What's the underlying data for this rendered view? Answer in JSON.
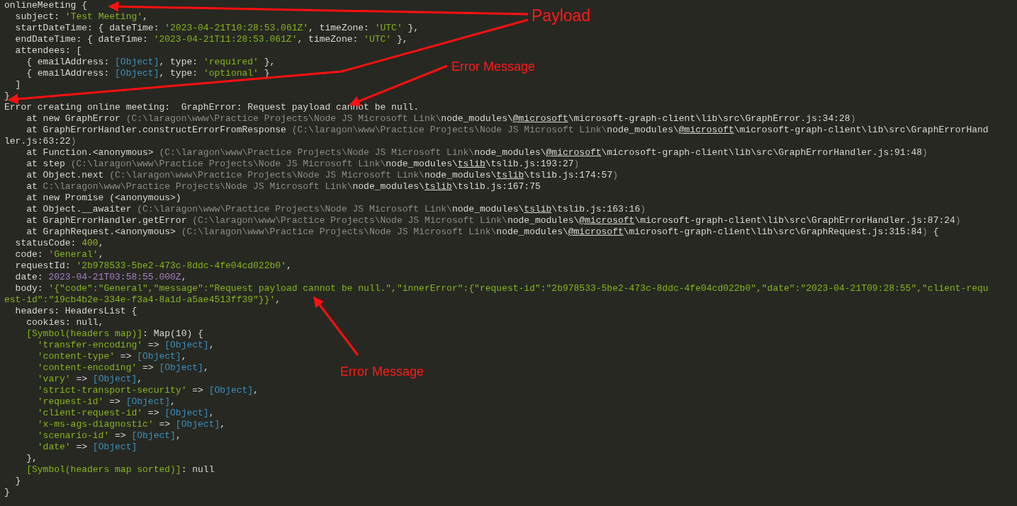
{
  "console": {
    "lines": [
      [
        {
          "kind": "t",
          "text": "onlineMeeting {"
        }
      ],
      [
        {
          "kind": "t",
          "text": "  subject: "
        },
        {
          "kind": "s",
          "text": "'Test Meeting'"
        },
        {
          "kind": "t",
          "text": ","
        }
      ],
      [
        {
          "kind": "t",
          "text": "  startDateTime: { dateTime: "
        },
        {
          "kind": "s",
          "text": "'2023-04-21T10:28:53.061Z'"
        },
        {
          "kind": "t",
          "text": ", timeZone: "
        },
        {
          "kind": "s",
          "text": "'UTC'"
        },
        {
          "kind": "t",
          "text": " },"
        }
      ],
      [
        {
          "kind": "t",
          "text": "  endDateTime: { dateTime: "
        },
        {
          "kind": "s",
          "text": "'2023-04-21T11:28:53.061Z'"
        },
        {
          "kind": "t",
          "text": ", timeZone: "
        },
        {
          "kind": "s",
          "text": "'UTC'"
        },
        {
          "kind": "t",
          "text": " },"
        }
      ],
      [
        {
          "kind": "t",
          "text": "  attendees: ["
        }
      ],
      [
        {
          "kind": "t",
          "text": "    { emailAddress: "
        },
        {
          "kind": "o",
          "text": "[Object]"
        },
        {
          "kind": "t",
          "text": ", type: "
        },
        {
          "kind": "s",
          "text": "'required'"
        },
        {
          "kind": "t",
          "text": " },"
        }
      ],
      [
        {
          "kind": "t",
          "text": "    { emailAddress: "
        },
        {
          "kind": "o",
          "text": "[Object]"
        },
        {
          "kind": "t",
          "text": ", type: "
        },
        {
          "kind": "s",
          "text": "'optional'"
        },
        {
          "kind": "t",
          "text": " }"
        }
      ],
      [
        {
          "kind": "t",
          "text": "  ]"
        }
      ],
      [
        {
          "kind": "t",
          "text": "}"
        }
      ],
      [
        {
          "kind": "t",
          "text": "Error creating online meeting:  GraphError: Request payload cannot be null."
        }
      ],
      [
        {
          "kind": "t",
          "text": "    at new GraphError "
        },
        {
          "kind": "d",
          "text": "(C:\\laragon\\www\\Practice Projects\\Node JS Microsoft Link\\"
        },
        {
          "kind": "t",
          "text": "node_modules\\"
        },
        {
          "kind": "u",
          "text": "@microsoft"
        },
        {
          "kind": "t",
          "text": "\\microsoft-graph-client\\lib\\src\\GraphError.js:34:28"
        },
        {
          "kind": "d",
          "text": ")"
        }
      ],
      [
        {
          "kind": "t",
          "text": "    at GraphErrorHandler.constructErrorFromResponse "
        },
        {
          "kind": "d",
          "text": "(C:\\laragon\\www\\Practice Projects\\Node JS Microsoft Link\\"
        },
        {
          "kind": "t",
          "text": "node_modules\\"
        },
        {
          "kind": "u",
          "text": "@microsoft"
        },
        {
          "kind": "t",
          "text": "\\microsoft-graph-client\\lib\\src\\GraphErrorHand"
        }
      ],
      [
        {
          "kind": "t",
          "text": "ler.js:63:22"
        },
        {
          "kind": "d",
          "text": ")"
        }
      ],
      [
        {
          "kind": "t",
          "text": "    at Function.<anonymous> "
        },
        {
          "kind": "d",
          "text": "(C:\\laragon\\www\\Practice Projects\\Node JS Microsoft Link\\"
        },
        {
          "kind": "t",
          "text": "node_modules\\"
        },
        {
          "kind": "u",
          "text": "@microsoft"
        },
        {
          "kind": "t",
          "text": "\\microsoft-graph-client\\lib\\src\\GraphErrorHandler.js:91:48"
        },
        {
          "kind": "d",
          "text": ")"
        }
      ],
      [
        {
          "kind": "t",
          "text": "    at step "
        },
        {
          "kind": "d",
          "text": "(C:\\laragon\\www\\Practice Projects\\Node JS Microsoft Link\\"
        },
        {
          "kind": "t",
          "text": "node_modules\\"
        },
        {
          "kind": "u",
          "text": "tslib"
        },
        {
          "kind": "t",
          "text": "\\tslib.js:193:27"
        },
        {
          "kind": "d",
          "text": ")"
        }
      ],
      [
        {
          "kind": "t",
          "text": "    at Object.next "
        },
        {
          "kind": "d",
          "text": "(C:\\laragon\\www\\Practice Projects\\Node JS Microsoft Link\\"
        },
        {
          "kind": "t",
          "text": "node_modules\\"
        },
        {
          "kind": "u",
          "text": "tslib"
        },
        {
          "kind": "t",
          "text": "\\tslib.js:174:57"
        },
        {
          "kind": "d",
          "text": ")"
        }
      ],
      [
        {
          "kind": "t",
          "text": "    at "
        },
        {
          "kind": "d",
          "text": "C:\\laragon\\www\\Practice Projects\\Node JS Microsoft Link\\"
        },
        {
          "kind": "t",
          "text": "node_modules\\"
        },
        {
          "kind": "u",
          "text": "tslib"
        },
        {
          "kind": "t",
          "text": "\\tslib.js:167:75"
        }
      ],
      [
        {
          "kind": "t",
          "text": "    at new Promise (<anonymous>)"
        }
      ],
      [
        {
          "kind": "t",
          "text": "    at Object.__awaiter "
        },
        {
          "kind": "d",
          "text": "(C:\\laragon\\www\\Practice Projects\\Node JS Microsoft Link\\"
        },
        {
          "kind": "t",
          "text": "node_modules\\"
        },
        {
          "kind": "u",
          "text": "tslib"
        },
        {
          "kind": "t",
          "text": "\\tslib.js:163:16"
        },
        {
          "kind": "d",
          "text": ")"
        }
      ],
      [
        {
          "kind": "t",
          "text": "    at GraphErrorHandler.getError "
        },
        {
          "kind": "d",
          "text": "(C:\\laragon\\www\\Practice Projects\\Node JS Microsoft Link\\"
        },
        {
          "kind": "t",
          "text": "node_modules\\"
        },
        {
          "kind": "u",
          "text": "@microsoft"
        },
        {
          "kind": "t",
          "text": "\\microsoft-graph-client\\lib\\src\\GraphErrorHandler.js:87:24"
        },
        {
          "kind": "d",
          "text": ")"
        }
      ],
      [
        {
          "kind": "t",
          "text": "    at GraphRequest.<anonymous> "
        },
        {
          "kind": "d",
          "text": "(C:\\laragon\\www\\Practice Projects\\Node JS Microsoft Link\\"
        },
        {
          "kind": "t",
          "text": "node_modules\\"
        },
        {
          "kind": "u",
          "text": "@microsoft"
        },
        {
          "kind": "t",
          "text": "\\microsoft-graph-client\\lib\\src\\GraphRequest.js:315:84"
        },
        {
          "kind": "d",
          "text": ")"
        },
        {
          "kind": "t",
          "text": " {"
        }
      ],
      [
        {
          "kind": "t",
          "text": "  statusCode: "
        },
        {
          "kind": "n",
          "text": "400"
        },
        {
          "kind": "t",
          "text": ","
        }
      ],
      [
        {
          "kind": "t",
          "text": "  code: "
        },
        {
          "kind": "s",
          "text": "'General'"
        },
        {
          "kind": "t",
          "text": ","
        }
      ],
      [
        {
          "kind": "t",
          "text": "  requestId: "
        },
        {
          "kind": "s",
          "text": "'2b978533-5be2-473c-8ddc-4fe04cd022b0'"
        },
        {
          "kind": "t",
          "text": ","
        }
      ],
      [
        {
          "kind": "t",
          "text": "  date: "
        },
        {
          "kind": "m",
          "text": "2023-04-21T03:58:55.000Z"
        },
        {
          "kind": "t",
          "text": ","
        }
      ],
      [
        {
          "kind": "t",
          "text": "  body: "
        },
        {
          "kind": "s",
          "text": "'{\"code\":\"General\",\"message\":\"Request payload cannot be null.\",\"innerError\":{\"request-id\":\"2b978533-5be2-473c-8ddc-4fe04cd022b0\",\"date\":\"2023-04-21T09:28:55\",\"client-requ"
        }
      ],
      [
        {
          "kind": "s",
          "text": "est-id\":\"19cb4b2e-334e-f3a4-8a1d-a5ae4513ff39\"}}'"
        },
        {
          "kind": "t",
          "text": ","
        }
      ],
      [
        {
          "kind": "t",
          "text": "  headers: HeadersList {"
        }
      ],
      [
        {
          "kind": "t",
          "text": "    cookies: null,"
        }
      ],
      [
        {
          "kind": "s",
          "text": "    [Symbol(headers map)]"
        },
        {
          "kind": "t",
          "text": ": Map(10) {"
        }
      ],
      [
        {
          "kind": "s",
          "text": "      'transfer-encoding'"
        },
        {
          "kind": "t",
          "text": " => "
        },
        {
          "kind": "o",
          "text": "[Object]"
        },
        {
          "kind": "t",
          "text": ","
        }
      ],
      [
        {
          "kind": "s",
          "text": "      'content-type'"
        },
        {
          "kind": "t",
          "text": " => "
        },
        {
          "kind": "o",
          "text": "[Object]"
        },
        {
          "kind": "t",
          "text": ","
        }
      ],
      [
        {
          "kind": "s",
          "text": "      'content-encoding'"
        },
        {
          "kind": "t",
          "text": " => "
        },
        {
          "kind": "o",
          "text": "[Object]"
        },
        {
          "kind": "t",
          "text": ","
        }
      ],
      [
        {
          "kind": "s",
          "text": "      'vary'"
        },
        {
          "kind": "t",
          "text": " => "
        },
        {
          "kind": "o",
          "text": "[Object]"
        },
        {
          "kind": "t",
          "text": ","
        }
      ],
      [
        {
          "kind": "s",
          "text": "      'strict-transport-security'"
        },
        {
          "kind": "t",
          "text": " => "
        },
        {
          "kind": "o",
          "text": "[Object]"
        },
        {
          "kind": "t",
          "text": ","
        }
      ],
      [
        {
          "kind": "s",
          "text": "      'request-id'"
        },
        {
          "kind": "t",
          "text": " => "
        },
        {
          "kind": "o",
          "text": "[Object]"
        },
        {
          "kind": "t",
          "text": ","
        }
      ],
      [
        {
          "kind": "s",
          "text": "      'client-request-id'"
        },
        {
          "kind": "t",
          "text": " => "
        },
        {
          "kind": "o",
          "text": "[Object]"
        },
        {
          "kind": "t",
          "text": ","
        }
      ],
      [
        {
          "kind": "s",
          "text": "      'x-ms-ags-diagnostic'"
        },
        {
          "kind": "t",
          "text": " => "
        },
        {
          "kind": "o",
          "text": "[Object]"
        },
        {
          "kind": "t",
          "text": ","
        }
      ],
      [
        {
          "kind": "s",
          "text": "      'scenario-id'"
        },
        {
          "kind": "t",
          "text": " => "
        },
        {
          "kind": "o",
          "text": "[Object]"
        },
        {
          "kind": "t",
          "text": ","
        }
      ],
      [
        {
          "kind": "s",
          "text": "      'date'"
        },
        {
          "kind": "t",
          "text": " => "
        },
        {
          "kind": "o",
          "text": "[Object]"
        }
      ],
      [
        {
          "kind": "t",
          "text": "    },"
        }
      ],
      [
        {
          "kind": "s",
          "text": "    [Symbol(headers map sorted)]"
        },
        {
          "kind": "t",
          "text": ": null"
        }
      ],
      [
        {
          "kind": "t",
          "text": "  }"
        }
      ],
      [
        {
          "kind": "t",
          "text": "}"
        }
      ]
    ]
  },
  "annotations": [
    {
      "kind": "title",
      "text": "Payload"
    },
    {
      "kind": "label",
      "text": "Error Message"
    },
    {
      "kind": "label",
      "text": "Error Message"
    }
  ]
}
